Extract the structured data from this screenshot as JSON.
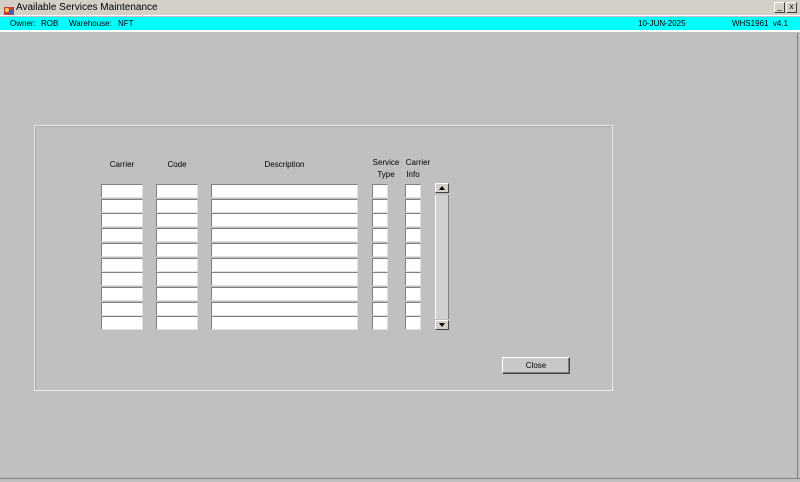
{
  "window": {
    "title": "Available Services Maintenance",
    "minimize_glyph": "_",
    "close_glyph": "x"
  },
  "status": {
    "owner_label": "Owner:",
    "owner_value": "ROB",
    "warehouse_label": "Warehouse:",
    "warehouse_value": "NFT",
    "date": "10-JUN-2025",
    "version": "WHS1961  v4.1",
    "bar_color": "#00ffff"
  },
  "grid": {
    "headers": {
      "carrier": "Carrier",
      "code": "Code",
      "description": "Description",
      "service_type_1": "Service",
      "service_type_2": "Type",
      "carrier_info_1": "Carrier",
      "carrier_info_2": "Info"
    },
    "rows": [
      {
        "carrier": "",
        "code": "",
        "description": "",
        "service_type": "",
        "carrier_info": ""
      },
      {
        "carrier": "",
        "code": "",
        "description": "",
        "service_type": "",
        "carrier_info": ""
      },
      {
        "carrier": "",
        "code": "",
        "description": "",
        "service_type": "",
        "carrier_info": ""
      },
      {
        "carrier": "",
        "code": "",
        "description": "",
        "service_type": "",
        "carrier_info": ""
      },
      {
        "carrier": "",
        "code": "",
        "description": "",
        "service_type": "",
        "carrier_info": ""
      },
      {
        "carrier": "",
        "code": "",
        "description": "",
        "service_type": "",
        "carrier_info": ""
      },
      {
        "carrier": "",
        "code": "",
        "description": "",
        "service_type": "",
        "carrier_info": ""
      },
      {
        "carrier": "",
        "code": "",
        "description": "",
        "service_type": "",
        "carrier_info": ""
      },
      {
        "carrier": "",
        "code": "",
        "description": "",
        "service_type": "",
        "carrier_info": ""
      },
      {
        "carrier": "",
        "code": "",
        "description": "",
        "service_type": "",
        "carrier_info": ""
      }
    ]
  },
  "actions": {
    "close_label": "Close"
  },
  "icons": {
    "app": "app-icon",
    "scroll_up": "scroll-up-arrow-icon",
    "scroll_down": "scroll-down-arrow-icon"
  }
}
